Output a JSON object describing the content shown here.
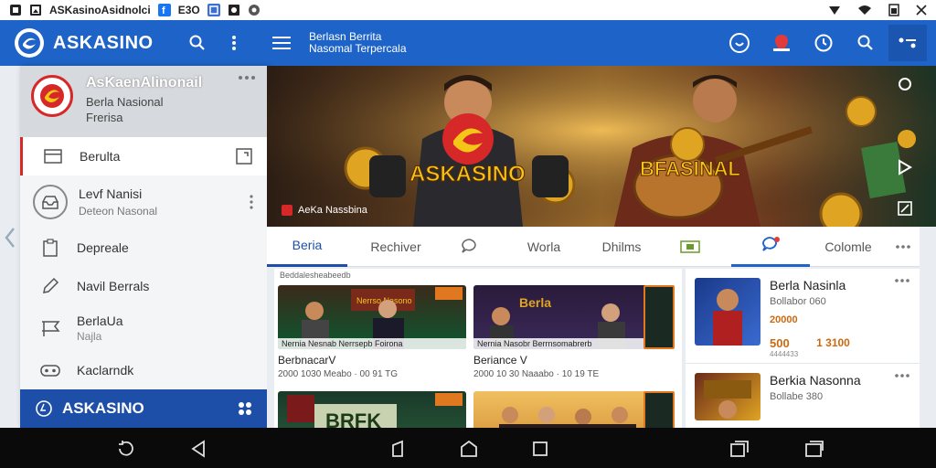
{
  "status_bar": {
    "app_title": "ASKasinoAsidnolci",
    "time_label": "E3O",
    "icons": [
      "sim-icon",
      "image-icon",
      "facebook-icon",
      "window-icon",
      "photo-icon",
      "chrome-icon",
      "signal-icon",
      "wifi-icon",
      "battery-icon",
      "close-icon"
    ]
  },
  "app_bar": {
    "brand": "ASKASINO",
    "title_line1": "Berlasn Berrita",
    "title_line2": "Nasomal Terpercala",
    "accent_color": "#1e63c8"
  },
  "sidebar": {
    "profile": {
      "name": "AsKaenAlinonail",
      "sub1": "Berla Nasional",
      "sub2": "Frerisa"
    },
    "items": [
      {
        "label": "Berulta",
        "icon": "window-icon",
        "active": true
      },
      {
        "label": "Depreale",
        "icon": "clipboard-icon"
      },
      {
        "label": "Navil Berrals",
        "icon": "pencil-icon"
      },
      {
        "label": "BerlaUa",
        "sub": "Najla",
        "icon": "flag-icon"
      },
      {
        "label": "Kaclarndk",
        "icon": "controller-icon"
      }
    ],
    "level": {
      "title": "Levf Nanisi",
      "sub": "Deteon Nasonal"
    },
    "footer": "ASKASINO"
  },
  "hero": {
    "left_badge": "ASKASINO",
    "right_badge": "BFASINAL",
    "caption": "AeKa Nassbina"
  },
  "tabs": [
    {
      "label": "Beria",
      "active": true
    },
    {
      "label": "Rechiver"
    },
    {
      "label": "",
      "icon": "chat-icon"
    },
    {
      "label": "Worla"
    },
    {
      "label": "Dhilms"
    },
    {
      "label": "",
      "icon": "film-icon"
    },
    {
      "label": "",
      "icon": "notification-icon",
      "active_icon": true
    },
    {
      "label": "Colomle"
    }
  ],
  "content_left": {
    "header": "Beddalesheabeedb",
    "cards": [
      {
        "thumb_label": "Nernia Nesnab Nerrsepb Foirona",
        "title": "BerbnacarV",
        "meta": "2000 1030 Meabo · 00 91 TG"
      },
      {
        "thumb_label": "Nernia Nasobr Berrnsomabrerb",
        "title": "Beriance V",
        "meta": "2000 10 30 Naaabo · 10 19 TE"
      },
      {
        "thumb_label": "",
        "title": "",
        "meta": ""
      },
      {
        "thumb_label": "",
        "title": "",
        "meta": ""
      }
    ],
    "card1_sign": "Nerrso Nasono",
    "card3_sign": "BRFK"
  },
  "content_right": {
    "items": [
      {
        "title": "Berla Nasinla",
        "sub": "Bollabor 060",
        "value": "20000",
        "stat1": "500",
        "stat1_sub": "4444433",
        "stat2": "1 3100"
      },
      {
        "title": "Berkia Nasonna",
        "sub": "Bollabe 380"
      }
    ]
  }
}
